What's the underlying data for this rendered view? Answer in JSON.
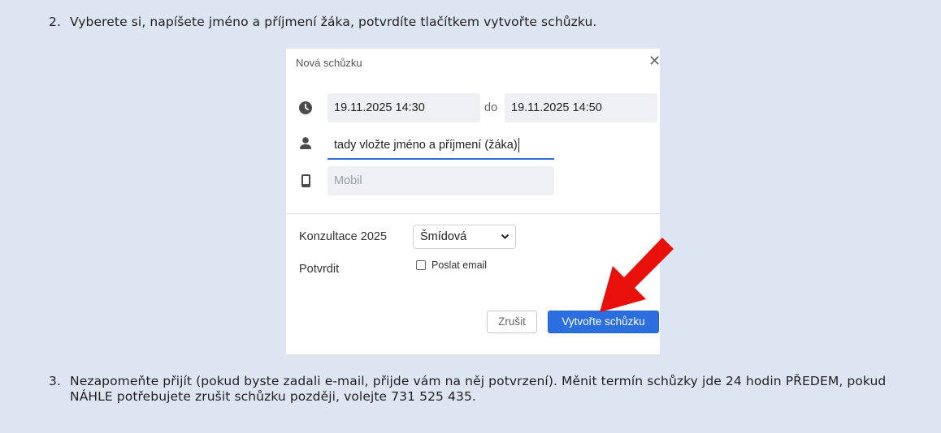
{
  "instructions": {
    "step2": {
      "number": "2.",
      "text": "Vyberete si, napíšete jméno a příjmení žáka, potvrdíte tlačítkem vytvořte schůzku."
    },
    "step3": {
      "number": "3.",
      "text": "Nezapomeňte přijít (pokud byste zadali e-mail, přijde vám na něj potvrzení). Měnit termín schůzky jde 24 hodin PŘEDEM, pokud NÁHLE potřebujete zrušit schůzku později, volejte 731 525 435."
    }
  },
  "dialog": {
    "title": "Nová schůzku",
    "close_label": "✕",
    "start_datetime": "19.11.2025  14:30",
    "range_separator": "do",
    "end_datetime": "19.11.2025  14:50",
    "name_value": "tady vložte jméno a příjmení (žáka)",
    "phone_placeholder": "Mobil",
    "meeting_label": "Konzultace 2025",
    "teacher_selected": "Šmídová",
    "confirm_label": "Potvrdit",
    "send_email_label": "Poslat email",
    "send_email_checked": false,
    "cancel_label": "Zrušit",
    "create_label": "Vytvořte schůzku"
  },
  "icons": {
    "clock": "clock-icon",
    "person": "person-icon",
    "phone": "phone-icon",
    "select": "chevron-down-icon",
    "annotation": "red-arrow-icon"
  },
  "colors": {
    "page_background": "#dde5f2",
    "primary_button": "#2a6ee0",
    "input_underline": "#2f6fdf",
    "annotation_arrow": "#e8100a"
  }
}
